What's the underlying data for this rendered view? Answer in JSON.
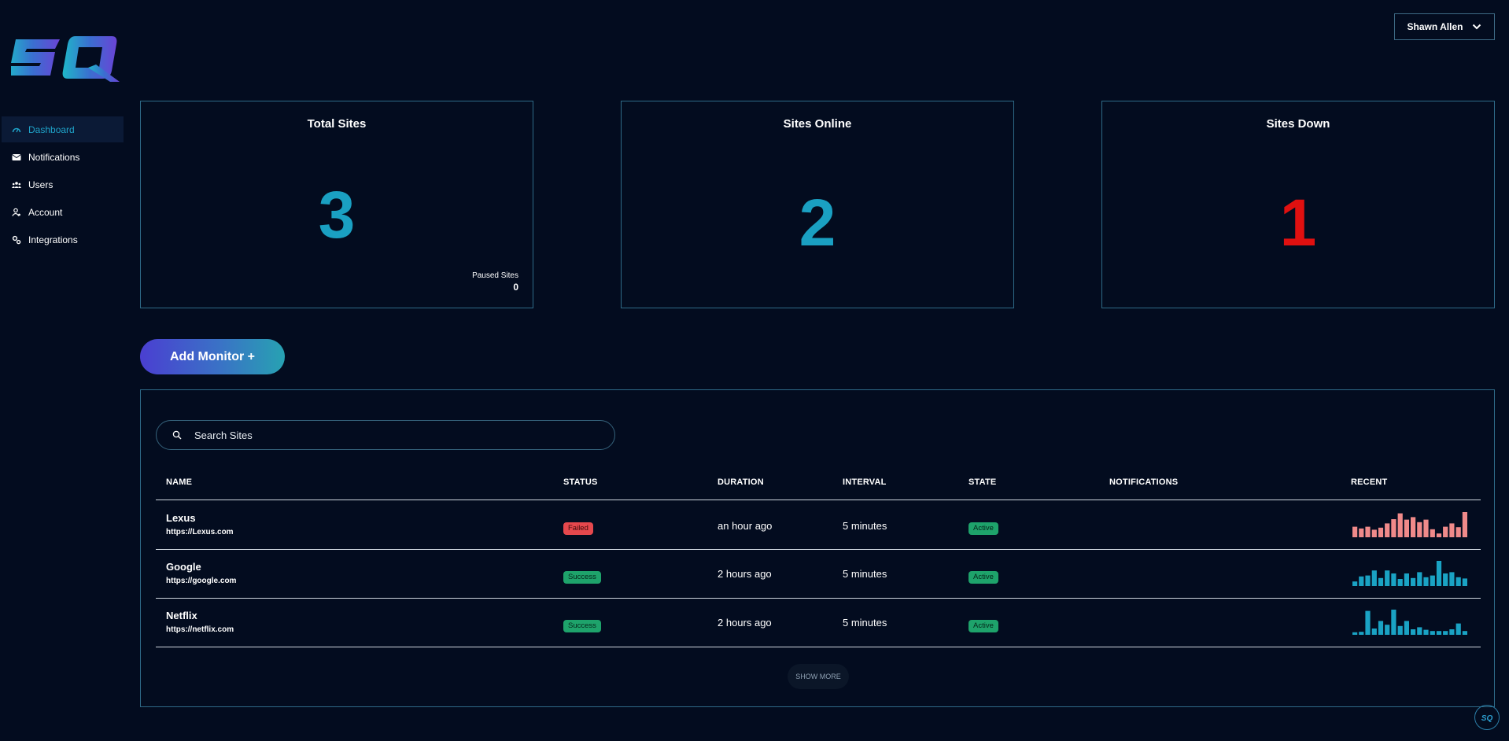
{
  "brand": {
    "logo_letters": "SQ"
  },
  "sidebar": {
    "items": [
      {
        "label": "Dashboard",
        "icon": "gauge-icon",
        "active": true
      },
      {
        "label": "Notifications",
        "icon": "envelope-icon",
        "active": false
      },
      {
        "label": "Users",
        "icon": "users-icon",
        "active": false
      },
      {
        "label": "Account",
        "icon": "user-gear-icon",
        "active": false
      },
      {
        "label": "Integrations",
        "icon": "cogs-icon",
        "active": false
      }
    ]
  },
  "header": {
    "user_name": "Shawn Allen"
  },
  "stats": {
    "total": {
      "title": "Total Sites",
      "value": "3",
      "paused_label": "Paused Sites",
      "paused_value": "0"
    },
    "online": {
      "title": "Sites Online",
      "value": "2"
    },
    "down": {
      "title": "Sites Down",
      "value": "1"
    }
  },
  "actions": {
    "add_monitor_label": "Add Monitor +"
  },
  "search": {
    "placeholder": "Search Sites"
  },
  "table": {
    "columns": [
      "NAME",
      "STATUS",
      "DURATION",
      "INTERVAL",
      "STATE",
      "NOTIFICATIONS",
      "RECENT"
    ],
    "rows": [
      {
        "name": "Lexus",
        "url": "https://Lexus.com",
        "status": "Failed",
        "duration": "an hour ago",
        "interval": "5 minutes",
        "state": "Active",
        "recent": [
          0.42,
          0.35,
          0.42,
          0.3,
          0.38,
          0.55,
          0.72,
          0.95,
          0.7,
          0.8,
          0.6,
          0.7,
          0.32,
          0.15,
          0.42,
          0.55,
          0.4,
          1.0
        ],
        "recent_color": "#f08a8a"
      },
      {
        "name": "Google",
        "url": "https://google.com",
        "status": "Success",
        "duration": "2 hours ago",
        "interval": "5 minutes",
        "state": "Active",
        "recent": [
          0.18,
          0.38,
          0.42,
          0.62,
          0.32,
          0.62,
          0.5,
          0.28,
          0.5,
          0.32,
          0.55,
          0.35,
          0.42,
          1.0,
          0.5,
          0.55,
          0.35,
          0.3
        ],
        "recent_color": "#1aa3c4"
      },
      {
        "name": "Netflix",
        "url": "https://netflix.com",
        "status": "Success",
        "duration": "2 hours ago",
        "interval": "5 minutes",
        "state": "Active",
        "recent": [
          0.1,
          0.12,
          0.95,
          0.25,
          0.55,
          0.4,
          1.0,
          0.35,
          0.55,
          0.22,
          0.3,
          0.2,
          0.15,
          0.15,
          0.15,
          0.22,
          0.45,
          0.15
        ],
        "recent_color": "#1aa3c4"
      }
    ],
    "show_more_label": "SHOW MORE"
  },
  "colors": {
    "accent": "#1fa3c9",
    "danger": "#e01010",
    "success": "#1ea36b",
    "border": "#2e6a87"
  }
}
